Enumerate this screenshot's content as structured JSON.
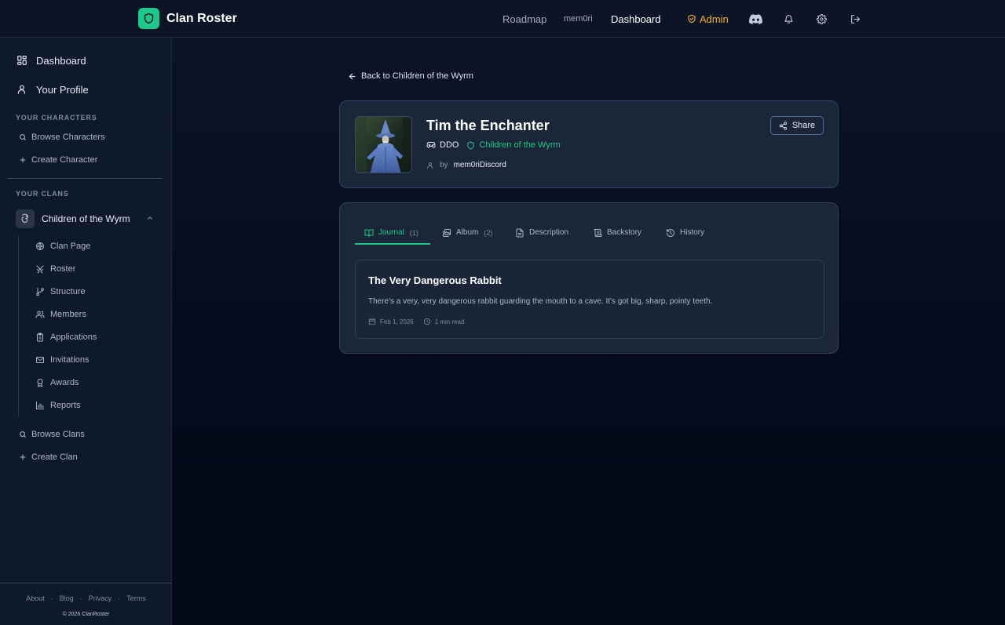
{
  "app": {
    "name": "Clan Roster",
    "accent_color": "#1cc88a",
    "admin_color": "#f2b02f",
    "brand_icon": "shield-icon"
  },
  "topnav": {
    "roadmap": "Roadmap",
    "username": "mem0ri",
    "dashboard": "Dashboard",
    "admin": "Admin",
    "icons": [
      "discord-icon",
      "bell-icon",
      "gear-icon",
      "logout-icon"
    ]
  },
  "sidebar": {
    "dashboard": "Dashboard",
    "profile": "Your Profile",
    "characters_heading": "YOUR CHARACTERS",
    "browse_characters": "Browse Characters",
    "create_character": "Create Character",
    "clans_heading": "YOUR CLANS",
    "clan": {
      "name": "Children of the Wyrm",
      "items": [
        "Clan Page",
        "Roster",
        "Structure",
        "Members",
        "Applications",
        "Invitations",
        "Awards",
        "Reports"
      ]
    },
    "browse_clans": "Browse Clans",
    "create_clan": "Create Clan",
    "footer": {
      "links": [
        "About",
        "Blog",
        "Privacy",
        "Terms"
      ],
      "separator": "·",
      "copyright": "© 2026 ClanRoster"
    }
  },
  "main": {
    "back_link": "Back to Children of the Wyrm",
    "character": {
      "name": "Tim the Enchanter",
      "game": "DDO",
      "clan": "Children of the Wyrm",
      "by_label": "by",
      "owner": "mem0riDiscord",
      "share": "Share"
    },
    "tabs": [
      {
        "label": "Journal",
        "count": "(1)",
        "active": true
      },
      {
        "label": "Album",
        "count": "(2)",
        "active": false
      },
      {
        "label": "Description",
        "count": "",
        "active": false
      },
      {
        "label": "Backstory",
        "count": "",
        "active": false
      },
      {
        "label": "History",
        "count": "",
        "active": false
      }
    ],
    "journal_entry": {
      "title": "The Very Dangerous Rabbit",
      "body": "There's a very, very dangerous rabbit guarding the mouth to a cave. It's got big, sharp, pointy teeth.",
      "date": "Feb 1, 2026",
      "read_time": "1 min read"
    }
  }
}
